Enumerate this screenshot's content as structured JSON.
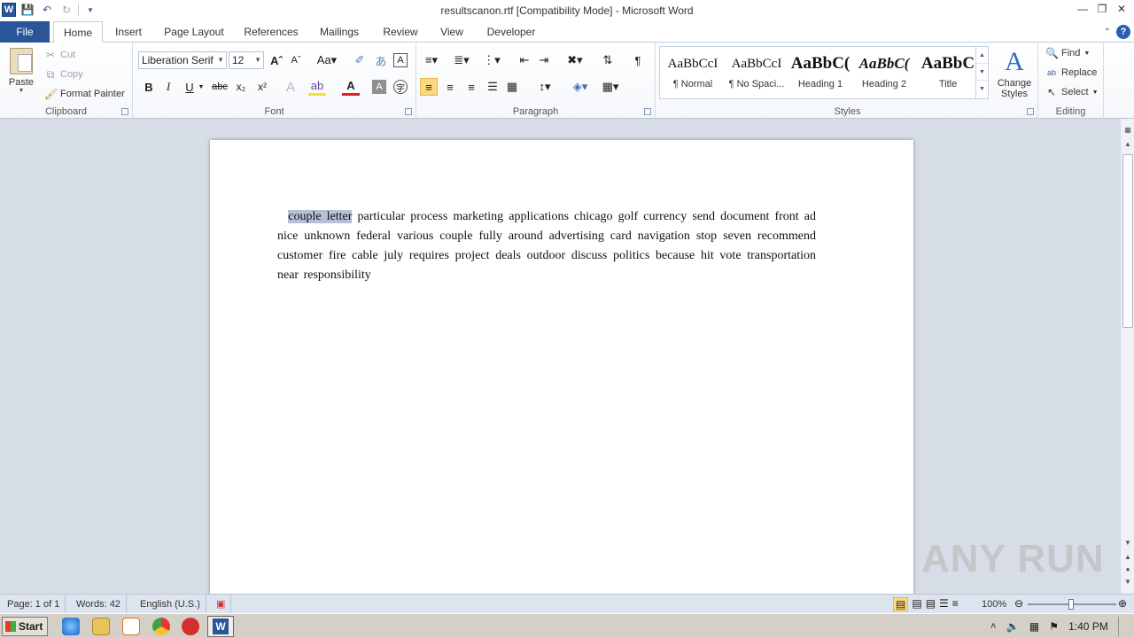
{
  "window": {
    "title": "resultscanon.rtf [Compatibility Mode]  -  Microsoft Word",
    "controls": [
      "minimize",
      "maximize",
      "close"
    ]
  },
  "tabs": [
    "File",
    "Home",
    "Insert",
    "Page Layout",
    "References",
    "Mailings",
    "Review",
    "View",
    "Developer"
  ],
  "active_tab": "Home",
  "clipboard": {
    "paste": "Paste",
    "cut": "Cut",
    "copy": "Copy",
    "format_painter": "Format Painter",
    "label": "Clipboard"
  },
  "font": {
    "family": "Liberation Serif",
    "size": "12",
    "label": "Font"
  },
  "paragraph": {
    "label": "Paragraph"
  },
  "styles": {
    "label": "Styles",
    "items": [
      {
        "preview": "AaBbCcI",
        "name": "¶ Normal"
      },
      {
        "preview": "AaBbCcI",
        "name": "¶ No Spaci..."
      },
      {
        "preview": "AaBbC(",
        "name": "Heading 1"
      },
      {
        "preview": "AaBbC(",
        "name": "Heading 2"
      },
      {
        "preview": "AaBbC",
        "name": "Title"
      }
    ],
    "change_styles": "Change Styles"
  },
  "editing": {
    "label": "Editing",
    "find": "Find",
    "replace": "Replace",
    "select": "Select"
  },
  "document": {
    "selected_text": "couple letter",
    "body_text": " particular  process marketing  applications  chicago  golf  currency  send    document front    ad nice     unknown     federal     various  couple      fully     around      advertising  card navigation  stop    seven        recommend  customer  fire     cable july  requires  project        deals outdoor  discuss  politics  because  hit  vote transportation     near  responsibility"
  },
  "status": {
    "page": "Page: 1 of 1",
    "words": "Words: 42",
    "language": "English (U.S.)",
    "zoom": "100%"
  },
  "taskbar": {
    "start": "Start",
    "clock": "1:40 PM"
  },
  "watermark": "ANY RUN",
  "colors": {
    "file_tab": "#2a5699",
    "selection": "#b5c1d7",
    "active_button": "#fcd87f"
  }
}
